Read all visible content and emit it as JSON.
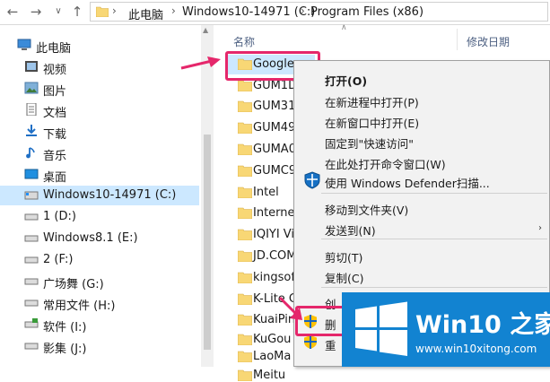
{
  "address": {
    "crumbs": [
      "此电脑",
      "Windows10-14971 (C:)",
      "Program Files (x86)"
    ]
  },
  "nav": {
    "items": [
      {
        "label": "此电脑",
        "icon": "computer-icon"
      },
      {
        "label": "视频",
        "icon": "video-folder-icon"
      },
      {
        "label": "图片",
        "icon": "pictures-folder-icon"
      },
      {
        "label": "文档",
        "icon": "documents-folder-icon"
      },
      {
        "label": "下载",
        "icon": "downloads-folder-icon"
      },
      {
        "label": "音乐",
        "icon": "music-folder-icon"
      },
      {
        "label": "桌面",
        "icon": "desktop-folder-icon"
      },
      {
        "label": "Windows10-14971 (C:)",
        "icon": "drive-icon"
      },
      {
        "label": "1 (D:)",
        "icon": "drive-icon"
      },
      {
        "label": "Windows8.1 (E:)",
        "icon": "drive-icon"
      },
      {
        "label": "2 (F:)",
        "icon": "drive-icon"
      },
      {
        "label": "广场舞 (G:)",
        "icon": "drive-icon"
      },
      {
        "label": "常用文件 (H:)",
        "icon": "drive-icon"
      },
      {
        "label": "软件 (I:)",
        "icon": "drive-icon"
      },
      {
        "label": "影集 (J:)",
        "icon": "drive-icon"
      }
    ]
  },
  "list": {
    "col_name": "名称",
    "col_date": "修改日期",
    "files": [
      "Google",
      "GUM1D",
      "GUM31",
      "GUM49",
      "GUMA0",
      "GUMC9",
      "Intel",
      "Internet",
      "IQIYI Vi",
      "JD.COM",
      "kingsoft",
      "K-Lite C",
      "KuaiPing",
      "KuGou",
      "LaoMa",
      "Meitu"
    ]
  },
  "context_menu": {
    "items": [
      "打开(O)",
      "在新进程中打开(P)",
      "在新窗口中打开(E)",
      "固定到\"快速访问\"",
      "在此处打开命令窗口(W)",
      "使用 Windows Defender扫描...",
      "移动到文件夹(V)",
      "发送到(N)",
      "剪切(T)",
      "复制(C)",
      "创",
      "删",
      "重"
    ]
  },
  "watermark": {
    "title": "Win10 之家",
    "url": "www.win10xitong.com"
  },
  "colors": {
    "selection": "#cce8ff",
    "highlight": "#e5276b",
    "folder": "#f8d775",
    "watermark_bg": "#1283d1"
  }
}
